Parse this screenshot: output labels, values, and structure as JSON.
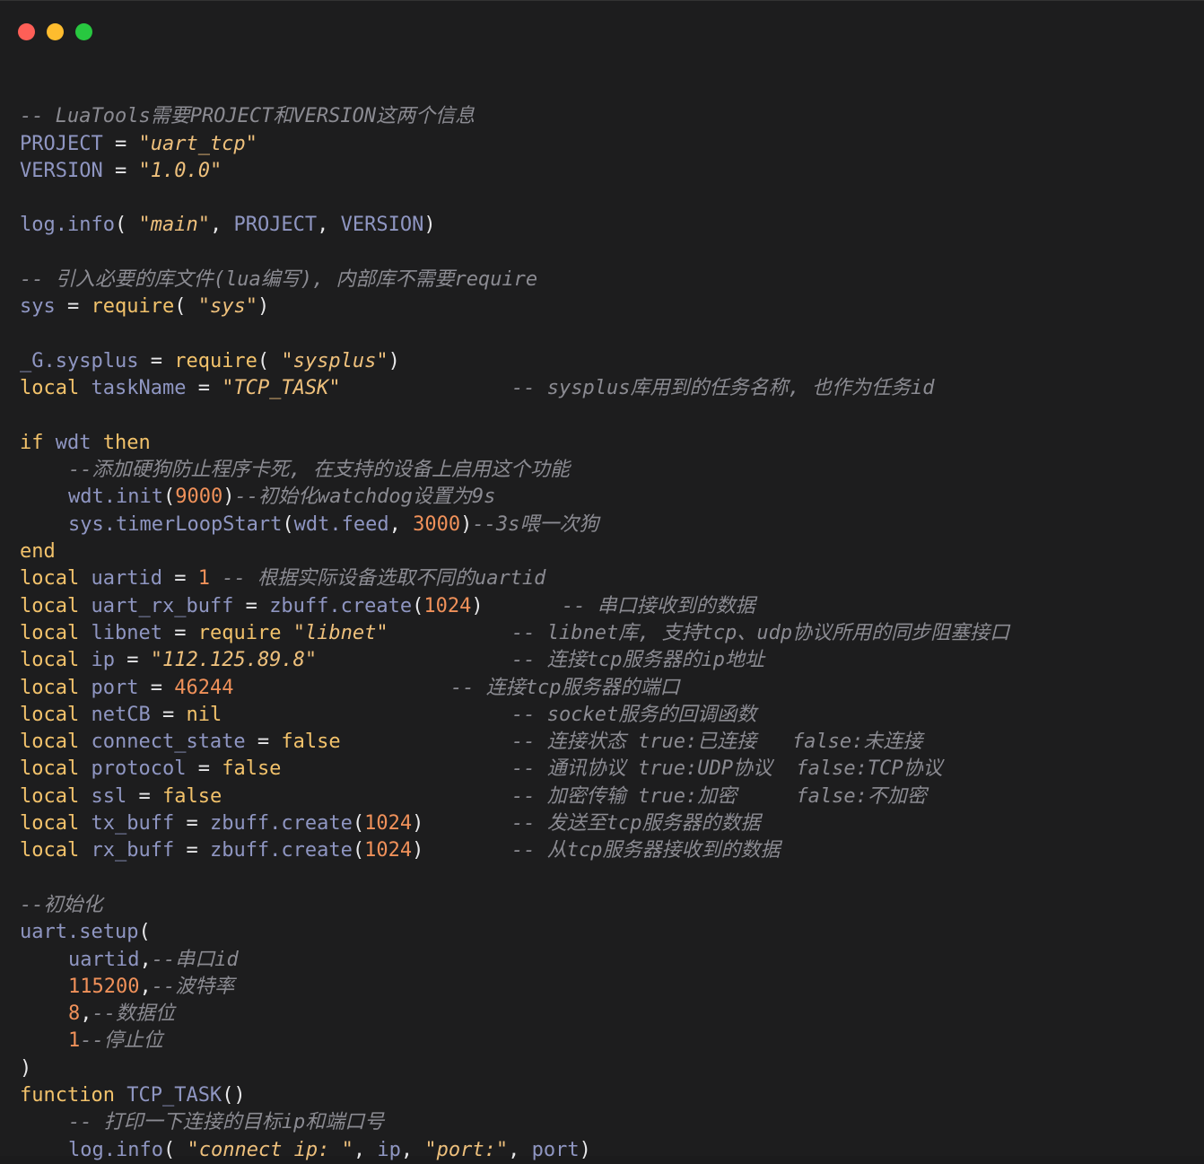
{
  "window": {
    "controls": [
      {
        "name": "close",
        "color": "#fe5f57"
      },
      {
        "name": "minimize",
        "color": "#febc2e"
      },
      {
        "name": "maximize",
        "color": "#28c840"
      }
    ]
  },
  "code": {
    "lines": [
      {
        "indent": 0,
        "tokens": []
      },
      {
        "indent": 0,
        "tokens": [
          {
            "t": "-- LuaTools需要PROJECT和VERSION这两个信息",
            "k": "c"
          }
        ]
      },
      {
        "indent": 0,
        "tokens": [
          {
            "t": "PROJECT",
            "k": "i"
          },
          {
            "t": " = ",
            "k": "p"
          },
          {
            "t": "\"uart_tcp\"",
            "k": "s"
          }
        ]
      },
      {
        "indent": 0,
        "tokens": [
          {
            "t": "VERSION",
            "k": "i"
          },
          {
            "t": " = ",
            "k": "p"
          },
          {
            "t": "\"1.0.0\"",
            "k": "s"
          }
        ]
      },
      {
        "indent": 0,
        "tokens": []
      },
      {
        "indent": 0,
        "tokens": [
          {
            "t": "log.info",
            "k": "i"
          },
          {
            "t": "( ",
            "k": "p"
          },
          {
            "t": "\"main\"",
            "k": "s"
          },
          {
            "t": ", ",
            "k": "p"
          },
          {
            "t": "PROJECT",
            "k": "i"
          },
          {
            "t": ", ",
            "k": "p"
          },
          {
            "t": "VERSION",
            "k": "i"
          },
          {
            "t": ")",
            "k": "p"
          }
        ]
      },
      {
        "indent": 0,
        "tokens": []
      },
      {
        "indent": 0,
        "tokens": [
          {
            "t": "-- 引入必要的库文件(lua编写), 内部库不需要require",
            "k": "c"
          }
        ]
      },
      {
        "indent": 0,
        "tokens": [
          {
            "t": "sys",
            "k": "i"
          },
          {
            "t": " = ",
            "k": "p"
          },
          {
            "t": "require",
            "k": "k"
          },
          {
            "t": "( ",
            "k": "p"
          },
          {
            "t": "\"sys\"",
            "k": "s"
          },
          {
            "t": ")",
            "k": "p"
          }
        ]
      },
      {
        "indent": 0,
        "tokens": []
      },
      {
        "indent": 0,
        "tokens": [
          {
            "t": "_G.sysplus",
            "k": "i"
          },
          {
            "t": " = ",
            "k": "p"
          },
          {
            "t": "require",
            "k": "k"
          },
          {
            "t": "( ",
            "k": "p"
          },
          {
            "t": "\"sysplus\"",
            "k": "s"
          },
          {
            "t": ")",
            "k": "p"
          }
        ]
      },
      {
        "indent": 0,
        "tokens": [
          {
            "t": "local",
            "k": "k"
          },
          {
            "t": " ",
            "k": "p"
          },
          {
            "t": "taskName",
            "k": "i"
          },
          {
            "t": " = ",
            "k": "p"
          },
          {
            "t": "\"TCP_TASK\"",
            "k": "s"
          }
        ],
        "comment": "-- sysplus库用到的任务名称, 也作为任务id",
        "cpos": 548
      },
      {
        "indent": 0,
        "tokens": []
      },
      {
        "indent": 0,
        "tokens": [
          {
            "t": "if",
            "k": "k"
          },
          {
            "t": " ",
            "k": "p"
          },
          {
            "t": "wdt",
            "k": "i"
          },
          {
            "t": " ",
            "k": "p"
          },
          {
            "t": "then",
            "k": "k"
          }
        ]
      },
      {
        "indent": 4,
        "tokens": [
          {
            "t": "--添加硬狗防止程序卡死, 在支持的设备上启用这个功能",
            "k": "c"
          }
        ]
      },
      {
        "indent": 4,
        "tokens": [
          {
            "t": "wdt.init",
            "k": "i"
          },
          {
            "t": "(",
            "k": "p"
          },
          {
            "t": "9000",
            "k": "n"
          },
          {
            "t": ")",
            "k": "p"
          },
          {
            "t": "--初始化watchdog设置为9s",
            "k": "c"
          }
        ]
      },
      {
        "indent": 4,
        "tokens": [
          {
            "t": "sys.timerLoopStart",
            "k": "i"
          },
          {
            "t": "(",
            "k": "p"
          },
          {
            "t": "wdt.feed",
            "k": "i"
          },
          {
            "t": ", ",
            "k": "p"
          },
          {
            "t": "3000",
            "k": "n"
          },
          {
            "t": ")",
            "k": "p"
          },
          {
            "t": "--3s喂一次狗",
            "k": "c"
          }
        ]
      },
      {
        "indent": 0,
        "tokens": [
          {
            "t": "end",
            "k": "k"
          }
        ]
      },
      {
        "indent": 0,
        "tokens": [
          {
            "t": "local",
            "k": "k"
          },
          {
            "t": " ",
            "k": "p"
          },
          {
            "t": "uartid",
            "k": "i"
          },
          {
            "t": " = ",
            "k": "p"
          },
          {
            "t": "1",
            "k": "n"
          },
          {
            "t": " -- 根据实际设备选取不同的uartid",
            "k": "c"
          }
        ]
      },
      {
        "indent": 0,
        "tokens": [
          {
            "t": "local",
            "k": "k"
          },
          {
            "t": " ",
            "k": "p"
          },
          {
            "t": "uart_rx_buff",
            "k": "i"
          },
          {
            "t": " = ",
            "k": "p"
          },
          {
            "t": "zbuff.create",
            "k": "i"
          },
          {
            "t": "(",
            "k": "p"
          },
          {
            "t": "1024",
            "k": "n"
          },
          {
            "t": ")",
            "k": "p"
          }
        ],
        "comment": "-- 串口接收到的数据",
        "cpos": 604
      },
      {
        "indent": 0,
        "tokens": [
          {
            "t": "local",
            "k": "k"
          },
          {
            "t": " ",
            "k": "p"
          },
          {
            "t": "libnet",
            "k": "i"
          },
          {
            "t": " = ",
            "k": "p"
          },
          {
            "t": "require",
            "k": "k"
          },
          {
            "t": " ",
            "k": "p"
          },
          {
            "t": "\"libnet\"",
            "k": "s"
          }
        ],
        "comment": "-- libnet库, 支持tcp、udp协议所用的同步阻塞接口",
        "cpos": 548
      },
      {
        "indent": 0,
        "tokens": [
          {
            "t": "local",
            "k": "k"
          },
          {
            "t": " ",
            "k": "p"
          },
          {
            "t": "ip",
            "k": "i"
          },
          {
            "t": " = ",
            "k": "p"
          },
          {
            "t": "\"112.125.89.8\"",
            "k": "s"
          }
        ],
        "comment": "-- 连接tcp服务器的ip地址",
        "cpos": 548
      },
      {
        "indent": 0,
        "tokens": [
          {
            "t": "local",
            "k": "k"
          },
          {
            "t": " ",
            "k": "p"
          },
          {
            "t": "port",
            "k": "i"
          },
          {
            "t": " = ",
            "k": "p"
          },
          {
            "t": "46244",
            "k": "n"
          }
        ],
        "comment": "-- 连接tcp服务器的端口",
        "cpos": 480
      },
      {
        "indent": 0,
        "tokens": [
          {
            "t": "local",
            "k": "k"
          },
          {
            "t": " ",
            "k": "p"
          },
          {
            "t": "netCB",
            "k": "i"
          },
          {
            "t": " = ",
            "k": "p"
          },
          {
            "t": "nil",
            "k": "k"
          }
        ],
        "comment": "-- socket服务的回调函数",
        "cpos": 548
      },
      {
        "indent": 0,
        "tokens": [
          {
            "t": "local",
            "k": "k"
          },
          {
            "t": " ",
            "k": "p"
          },
          {
            "t": "connect_state",
            "k": "i"
          },
          {
            "t": " = ",
            "k": "p"
          },
          {
            "t": "false",
            "k": "k"
          }
        ],
        "comment": "-- 连接状态 true:已连接   false:未连接",
        "cpos": 548
      },
      {
        "indent": 0,
        "tokens": [
          {
            "t": "local",
            "k": "k"
          },
          {
            "t": " ",
            "k": "p"
          },
          {
            "t": "protocol",
            "k": "i"
          },
          {
            "t": " = ",
            "k": "p"
          },
          {
            "t": "false",
            "k": "k"
          }
        ],
        "comment": "-- 通讯协议 true:UDP协议  false:TCP协议",
        "cpos": 548
      },
      {
        "indent": 0,
        "tokens": [
          {
            "t": "local",
            "k": "k"
          },
          {
            "t": " ",
            "k": "p"
          },
          {
            "t": "ssl",
            "k": "i"
          },
          {
            "t": " = ",
            "k": "p"
          },
          {
            "t": "false",
            "k": "k"
          }
        ],
        "comment": "-- 加密传输 true:加密     false:不加密",
        "cpos": 548
      },
      {
        "indent": 0,
        "tokens": [
          {
            "t": "local",
            "k": "k"
          },
          {
            "t": " ",
            "k": "p"
          },
          {
            "t": "tx_buff",
            "k": "i"
          },
          {
            "t": " = ",
            "k": "p"
          },
          {
            "t": "zbuff.create",
            "k": "i"
          },
          {
            "t": "(",
            "k": "p"
          },
          {
            "t": "1024",
            "k": "n"
          },
          {
            "t": ")",
            "k": "p"
          }
        ],
        "comment": "-- 发送至tcp服务器的数据",
        "cpos": 548
      },
      {
        "indent": 0,
        "tokens": [
          {
            "t": "local",
            "k": "k"
          },
          {
            "t": " ",
            "k": "p"
          },
          {
            "t": "rx_buff",
            "k": "i"
          },
          {
            "t": " = ",
            "k": "p"
          },
          {
            "t": "zbuff.create",
            "k": "i"
          },
          {
            "t": "(",
            "k": "p"
          },
          {
            "t": "1024",
            "k": "n"
          },
          {
            "t": ")",
            "k": "p"
          }
        ],
        "comment": "-- 从tcp服务器接收到的数据",
        "cpos": 548
      },
      {
        "indent": 0,
        "tokens": []
      },
      {
        "indent": 0,
        "tokens": [
          {
            "t": "--初始化",
            "k": "c"
          }
        ]
      },
      {
        "indent": 0,
        "tokens": [
          {
            "t": "uart.setup",
            "k": "i"
          },
          {
            "t": "(",
            "k": "p"
          }
        ]
      },
      {
        "indent": 4,
        "tokens": [
          {
            "t": "uartid",
            "k": "i"
          },
          {
            "t": ",",
            "k": "p"
          },
          {
            "t": "--串口id",
            "k": "c"
          }
        ]
      },
      {
        "indent": 4,
        "tokens": [
          {
            "t": "115200",
            "k": "n"
          },
          {
            "t": ",",
            "k": "p"
          },
          {
            "t": "--波特率",
            "k": "c"
          }
        ]
      },
      {
        "indent": 4,
        "tokens": [
          {
            "t": "8",
            "k": "n"
          },
          {
            "t": ",",
            "k": "p"
          },
          {
            "t": "--数据位",
            "k": "c"
          }
        ]
      },
      {
        "indent": 4,
        "tokens": [
          {
            "t": "1",
            "k": "n"
          },
          {
            "t": "--停止位",
            "k": "c"
          }
        ]
      },
      {
        "indent": 0,
        "tokens": [
          {
            "t": ")",
            "k": "p"
          }
        ]
      },
      {
        "indent": 0,
        "tokens": [
          {
            "t": "function",
            "k": "k"
          },
          {
            "t": " ",
            "k": "p"
          },
          {
            "t": "TCP_TASK",
            "k": "i"
          },
          {
            "t": "()",
            "k": "p"
          }
        ]
      },
      {
        "indent": 4,
        "tokens": [
          {
            "t": "-- 打印一下连接的目标ip和端口号",
            "k": "c"
          }
        ]
      },
      {
        "indent": 4,
        "tokens": [
          {
            "t": "log.info",
            "k": "i"
          },
          {
            "t": "( ",
            "k": "p"
          },
          {
            "t": "\"connect ip: \"",
            "k": "s"
          },
          {
            "t": ", ",
            "k": "p"
          },
          {
            "t": "ip",
            "k": "i"
          },
          {
            "t": ", ",
            "k": "p"
          },
          {
            "t": "\"port:\"",
            "k": "s"
          },
          {
            "t": ", ",
            "k": "p"
          },
          {
            "t": "port",
            "k": "i"
          },
          {
            "t": ")",
            "k": "p"
          }
        ]
      }
    ]
  }
}
